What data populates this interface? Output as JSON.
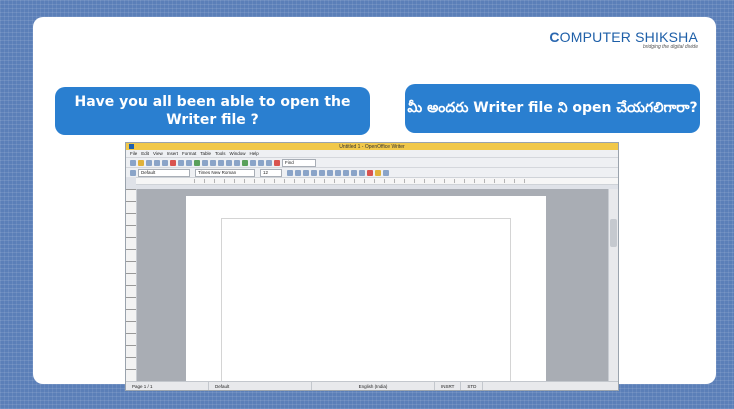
{
  "logo": {
    "main_prefix": "C",
    "main_rest": "OMPUTER SHIKSHA",
    "tagline": "bridging the digital divide"
  },
  "bubbles": {
    "left": "Have you all been able to open the Writer file ?",
    "right": "మీ అందరు Writer file ని open చేయగలిగారా?"
  },
  "writer": {
    "title": "Untitled 1 - OpenOffice Writer",
    "menu": [
      "File",
      "Edit",
      "View",
      "Insert",
      "Format",
      "Table",
      "Tools",
      "Window",
      "Help"
    ],
    "find_placeholder": "Find",
    "style_value": "Default",
    "font_value": "Times New Roman",
    "size_value": "12",
    "status": {
      "page": "Page 1 / 1",
      "style": "Default",
      "language": "English (India)",
      "mode": "INSRT",
      "selection": "STD"
    }
  },
  "colors": {
    "accent": "#2a7fd0",
    "background": "#5b7fb8",
    "title_bar": "#f1c84a"
  }
}
